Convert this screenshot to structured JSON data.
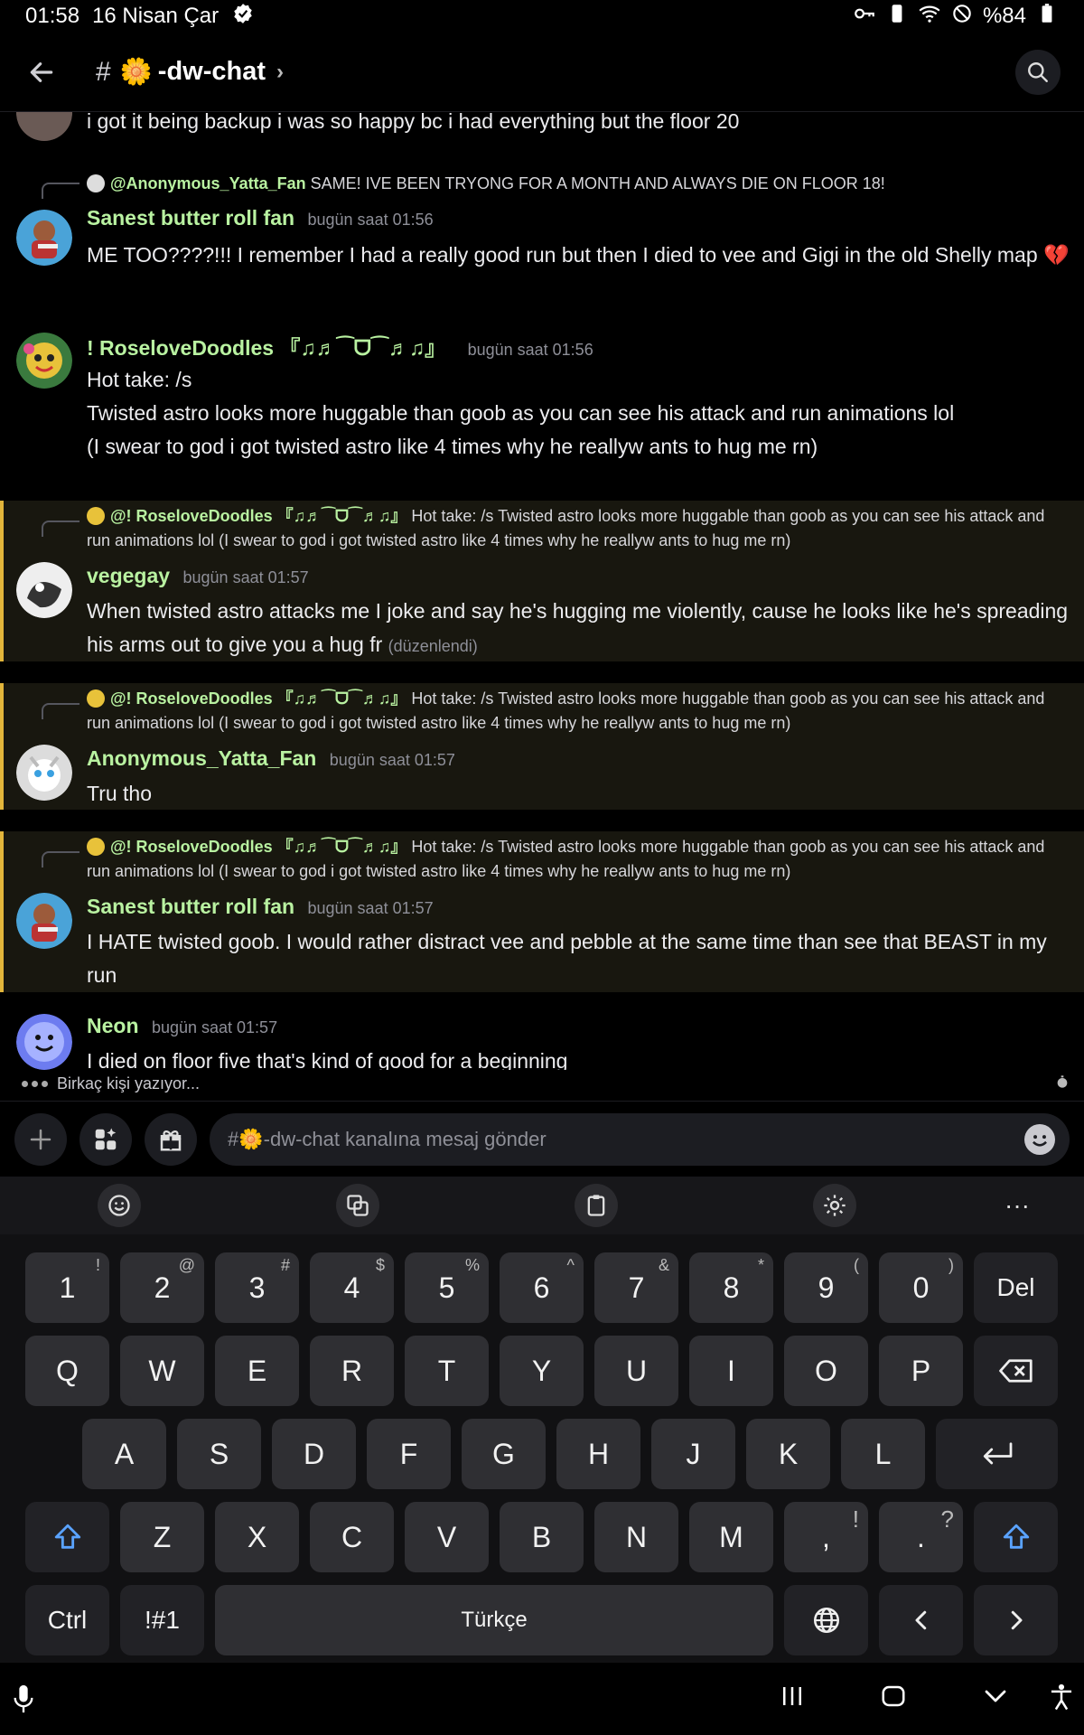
{
  "status": {
    "time": "01:58",
    "date": "16 Nisan Çar",
    "battery": "%84"
  },
  "header": {
    "hash": "#",
    "channel_emoji": "🌼",
    "channel_name": "-dw-chat",
    "chevron": "›"
  },
  "chat": {
    "partial_message": "i got it being backup i was so happy bc i had everything but the floor 20",
    "messages": [
      {
        "reply_name": "@Anonymous_Yatta_Fan",
        "reply_text": "SAME! IVE BEEN TRYONG FOR A MONTH AND ALWAYS DIE ON FLOOR 18!",
        "username": "Sanest butter roll fan",
        "time": "bugün saat 01:56",
        "text": "ME TOO????!!! I remember I had a really good run but then I died to vee and Gigi in the old Shelly map 💔"
      },
      {
        "username": "! RoseloveDoodles 『♫♬⁀ᗜ⁀♬♫』",
        "time": "bugün saat 01:56",
        "lines": [
          "Hot take: /s",
          "Twisted astro looks more huggable than goob as you can see his attack and run animations lol",
          "(I swear to god i got twisted astro like 4 times why he reallyw ants to hug me rn)"
        ]
      },
      {
        "reply_name": "@! RoseloveDoodles 『♫♬⁀ᗜ⁀♬♫』",
        "reply_text": "Hot take: /s Twisted astro looks more huggable than goob as you can see his attack and run animations lol (I swear to god i got twisted astro like 4 times why he reallyw ants to hug me rn)",
        "username": "vegegay",
        "time": "bugün saat 01:57",
        "text": "When twisted astro attacks me I joke and say he's hugging me violently, cause he looks like he's spreading his arms out to give you a hug fr",
        "edited": "(düzenlendi)"
      },
      {
        "reply_name": "@! RoseloveDoodles 『♫♬⁀ᗜ⁀♬♫』",
        "reply_text": "Hot take: /s Twisted astro looks more huggable than goob as you can see his attack and run animations lol (I swear to god i got twisted astro like 4 times why he reallyw ants to hug me rn)",
        "username": "Anonymous_Yatta_Fan",
        "time": "bugün saat 01:57",
        "text": "Tru tho"
      },
      {
        "reply_name": "@! RoseloveDoodles 『♫♬⁀ᗜ⁀♬♫』",
        "reply_text": "Hot take: /s Twisted astro looks more huggable than goob as you can see his attack and run animations lol (I swear to god i got twisted astro like 4 times why he reallyw ants to hug me rn)",
        "username": "Sanest butter roll fan",
        "time": "bugün saat 01:57",
        "text": "I HATE twisted goob. I would rather distract vee and pebble at the same time than see that BEAST in my run"
      },
      {
        "username": "Neon",
        "time": "bugün saat 01:57",
        "text": "I died on floor five that's kind of good for a beginning"
      }
    ]
  },
  "typing": "Birkaç kişi yazıyor...",
  "composer": {
    "placeholder": "#🌼-dw-chat kanalına mesaj gönder"
  },
  "keyboard": {
    "numbers": [
      "1",
      "2",
      "3",
      "4",
      "5",
      "6",
      "7",
      "8",
      "9",
      "0"
    ],
    "number_sups": [
      "!",
      "@",
      "#",
      "$",
      "%",
      "^",
      "&",
      "*",
      "(",
      ")"
    ],
    "del": "Del",
    "row1": [
      "Q",
      "W",
      "E",
      "R",
      "T",
      "Y",
      "U",
      "I",
      "O",
      "P"
    ],
    "row2": [
      "A",
      "S",
      "D",
      "F",
      "G",
      "H",
      "J",
      "K",
      "L"
    ],
    "row3": [
      "Z",
      "X",
      "C",
      "V",
      "B",
      "N",
      "M"
    ],
    "comma": ",",
    "comma_sup": "!",
    "period": ".",
    "period_sup": "?",
    "ctrl": "Ctrl",
    "symbols": "!#1",
    "space": "Türkçe"
  },
  "colors": {
    "username": "#b9f2a1",
    "highlight_border": "#e2b53b",
    "highlight_bg": "#18170f"
  }
}
